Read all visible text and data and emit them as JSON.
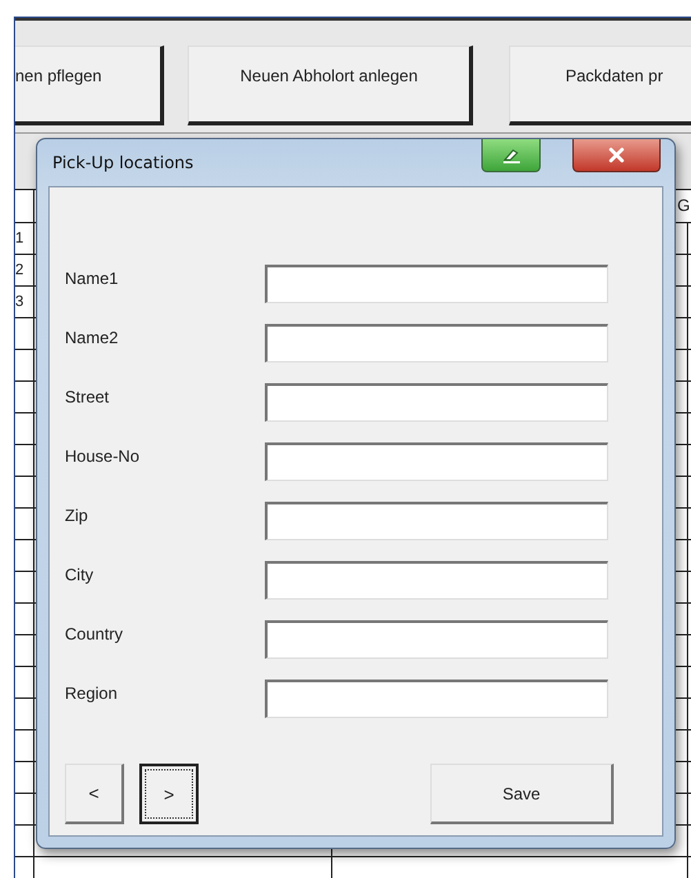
{
  "toolbar_buttons": [
    {
      "label": "nen pflegen"
    },
    {
      "label": "Neuen Abholort anlegen"
    },
    {
      "label": "Packdaten pr"
    }
  ],
  "sheet": {
    "column_header": "G",
    "row_headers": [
      "1",
      "2",
      "3"
    ]
  },
  "dialog": {
    "title": "Pick-Up locations",
    "fields": [
      {
        "label": "Name1"
      },
      {
        "label": "Name2"
      },
      {
        "label": "Street"
      },
      {
        "label": "House-No"
      },
      {
        "label": "Zip"
      },
      {
        "label": "City"
      },
      {
        "label": "Country"
      },
      {
        "label": "Region"
      }
    ],
    "nav_buttons": [
      {
        "label": "<",
        "focused": false
      },
      {
        "label": ">",
        "focused": true
      }
    ],
    "save_button": "Save"
  }
}
